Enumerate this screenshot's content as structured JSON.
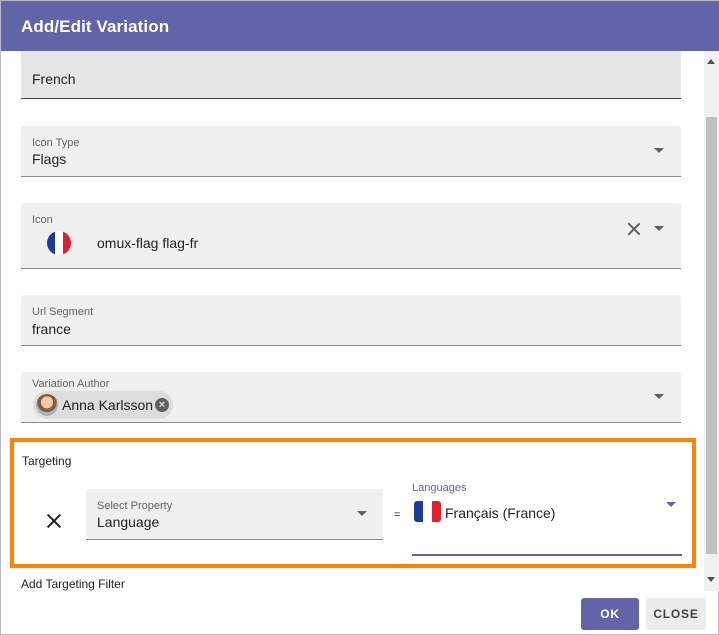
{
  "dialog": {
    "title": "Add/Edit Variation"
  },
  "fields": {
    "name_value": "French",
    "icon_type": {
      "label": "Icon Type",
      "value": "Flags"
    },
    "icon": {
      "label": "Icon",
      "value": "omux-flag flag-fr"
    },
    "url_segment": {
      "label": "Url Segment",
      "value": "france"
    },
    "variation_author": {
      "label": "Variation Author",
      "chip_name": "Anna Karlsson"
    }
  },
  "targeting": {
    "label": "Targeting",
    "rule": {
      "property_label": "Select Property",
      "property_value": "Language",
      "operator": "=",
      "languages_label": "Languages",
      "language_value": "Français (France)"
    },
    "add_filter_label": "Add Targeting Filter"
  },
  "buttons": {
    "ok": "OK",
    "close": "CLOSE"
  },
  "colors": {
    "header": "#6264a7",
    "highlight_border": "#ff8200",
    "ok_button": "#6264a7"
  },
  "icons": {
    "clear": "close-icon",
    "dropdown": "chevron-down-icon",
    "flag": "flag-fr-icon",
    "remove_chip": "remove-circle-icon"
  }
}
